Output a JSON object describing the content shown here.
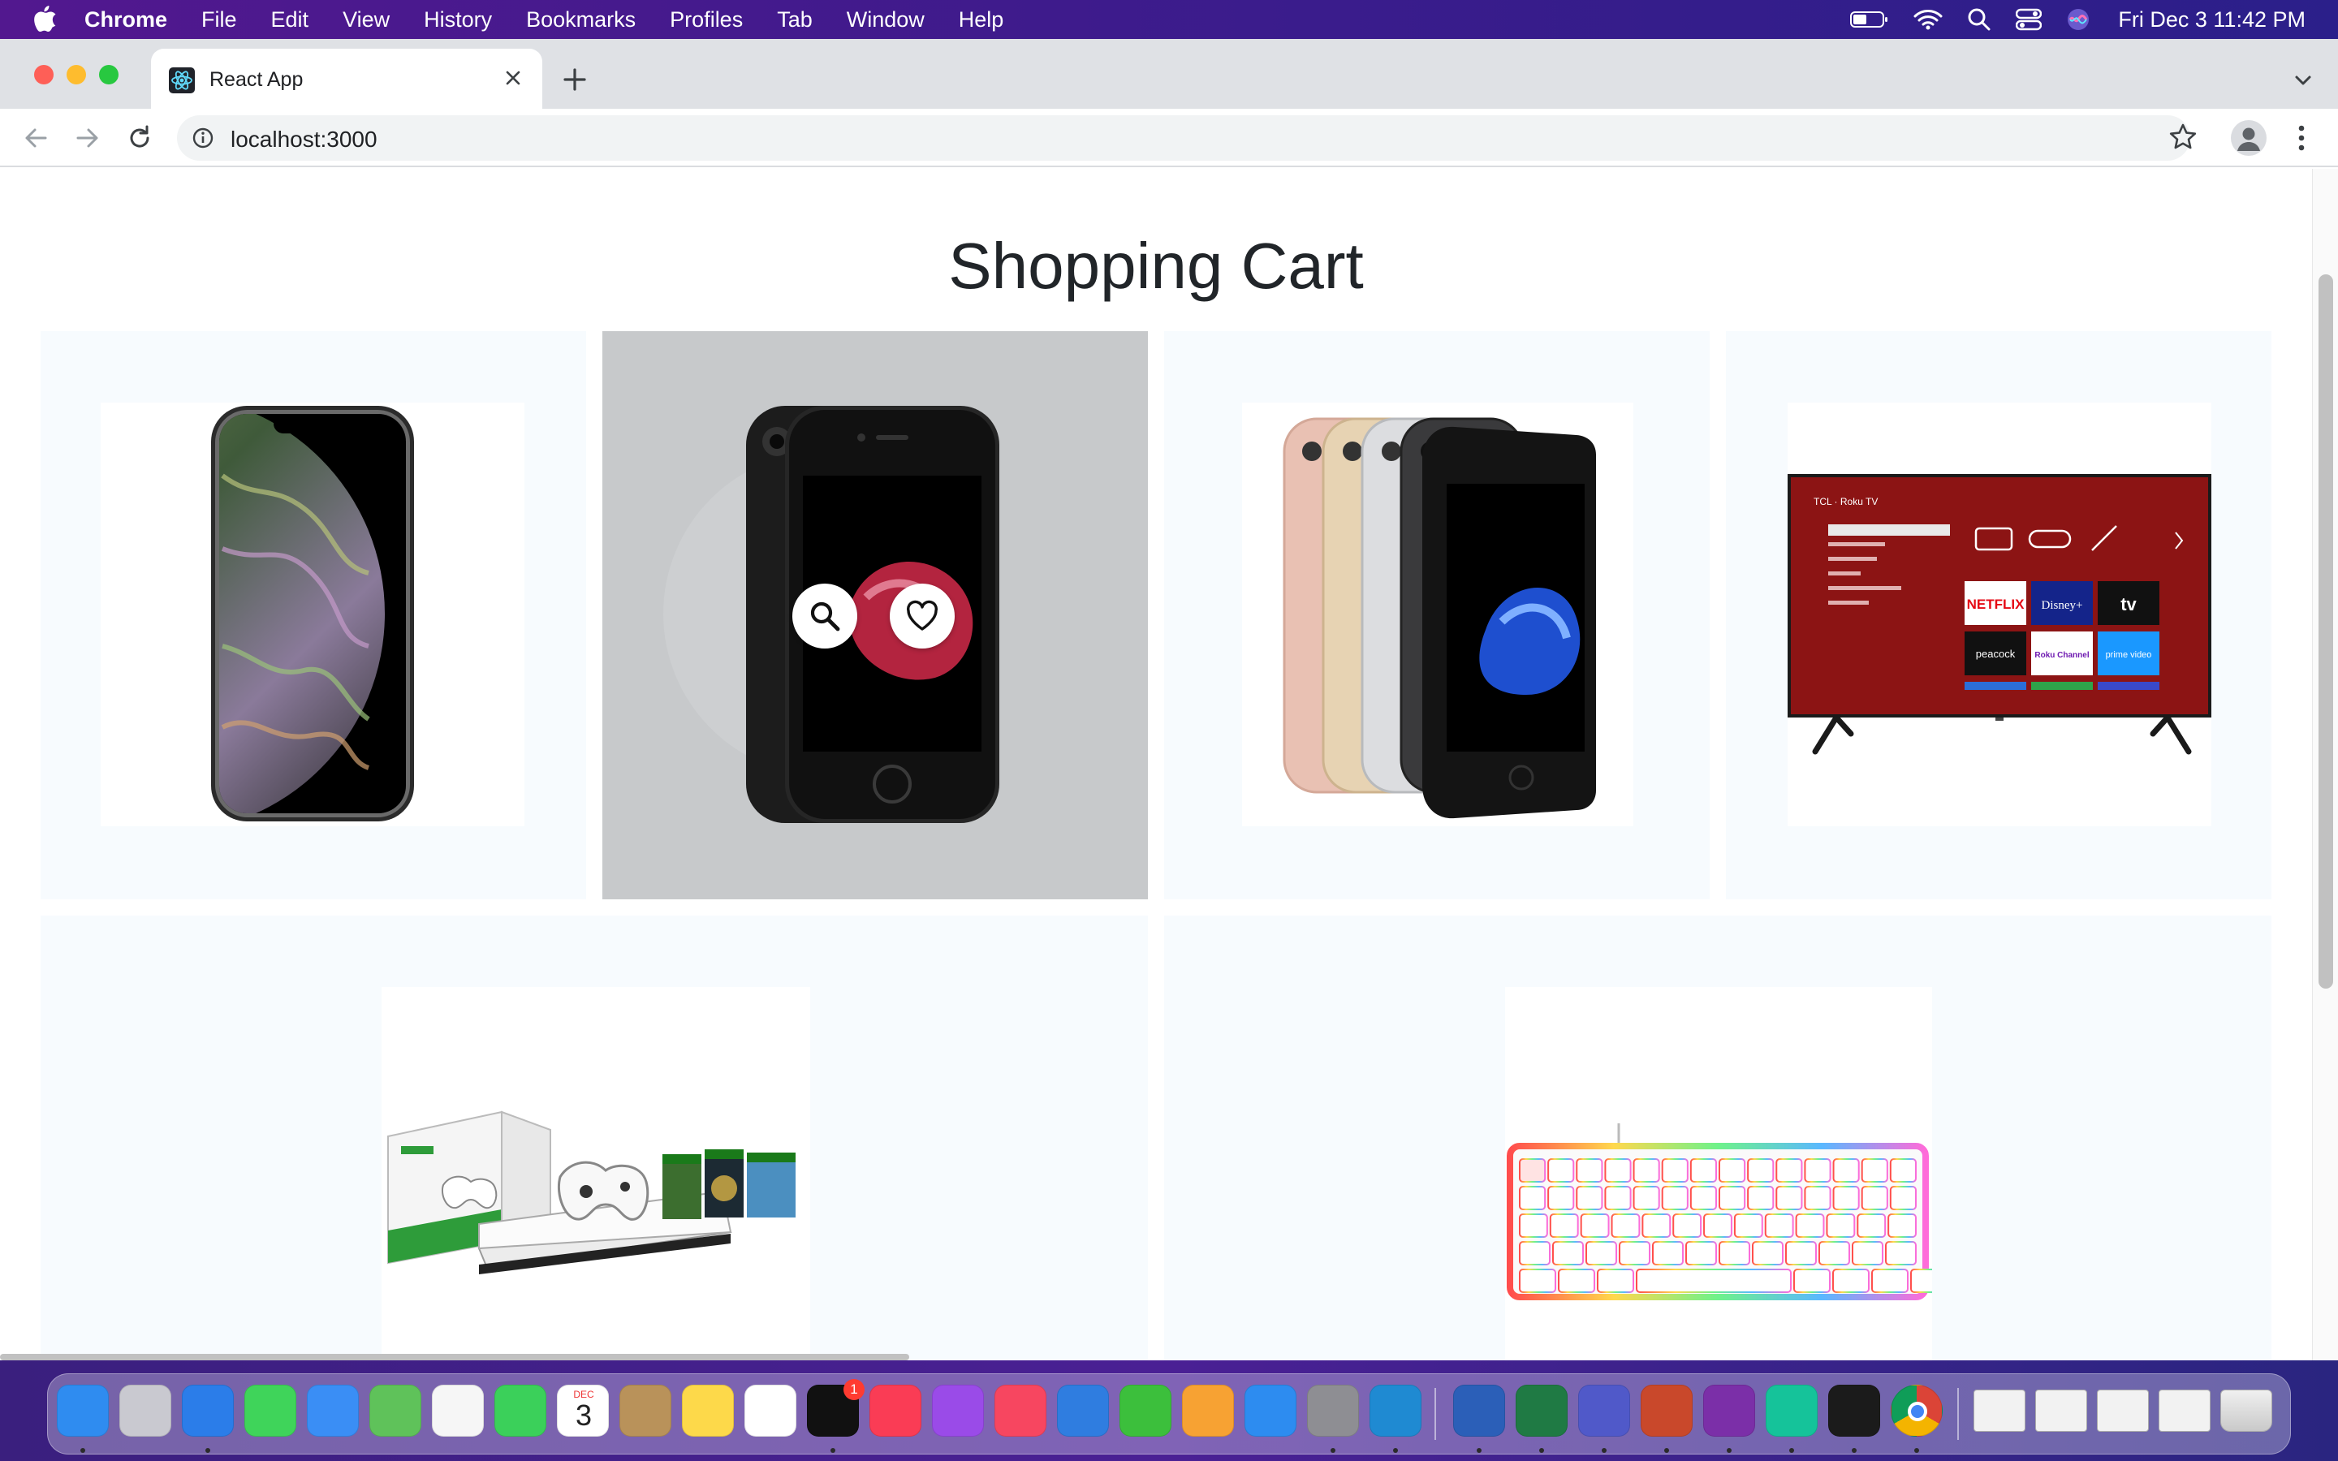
{
  "menubar": {
    "app_name": "Chrome",
    "items": [
      "File",
      "Edit",
      "View",
      "History",
      "Bookmarks",
      "Profiles",
      "Tab",
      "Window",
      "Help"
    ],
    "clock": "Fri Dec 3  11:42 PM"
  },
  "browser": {
    "tab_title": "React App",
    "url": "localhost:3000"
  },
  "page": {
    "title": "Shopping Cart",
    "products": [
      {
        "name": "iphone-xs-icon"
      },
      {
        "name": "iphone-7-black-icon",
        "hovered": true
      },
      {
        "name": "iphone-7-lineup-icon"
      },
      {
        "name": "tcl-roku-tv-icon"
      },
      {
        "name": "xbox-one-s-bundle-icon"
      },
      {
        "name": "rgb-keyboard-icon"
      }
    ],
    "tv_tiles": [
      "NETFLIX",
      "Disney+",
      "tv",
      "peacock",
      "Roku Channel",
      "prime video"
    ]
  },
  "dock": {
    "calendar_month": "DEC",
    "calendar_day": "3",
    "tv_badge": "1"
  },
  "colors": {
    "card_bg": "#f7fbfe",
    "card_hover_bg": "#c7c9cb",
    "title_text": "#212529"
  }
}
